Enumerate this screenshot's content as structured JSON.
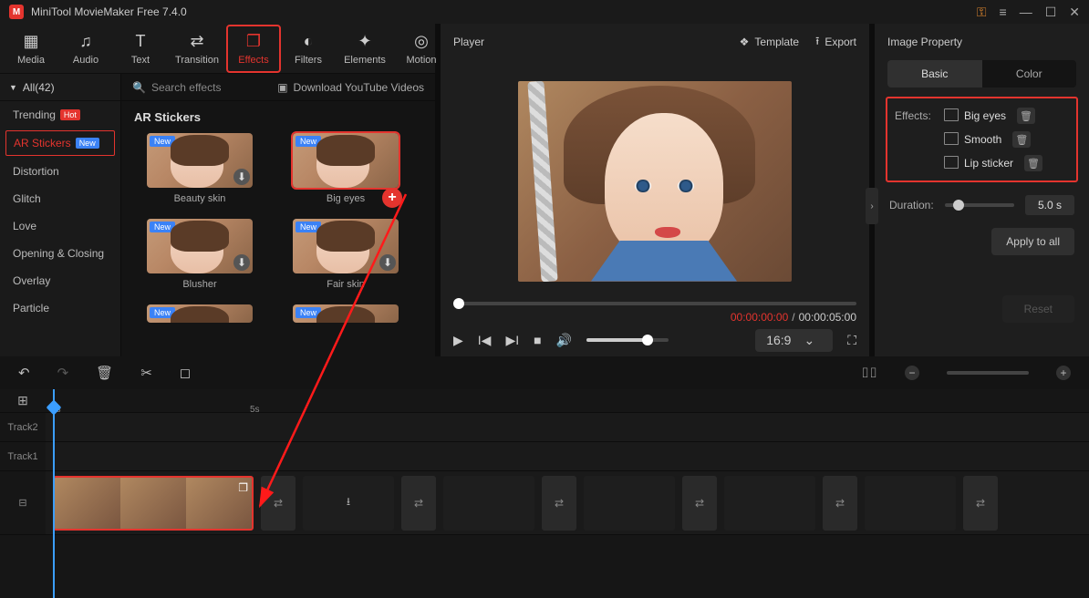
{
  "app": {
    "title": "MiniTool MovieMaker Free 7.4.0"
  },
  "tabs": [
    {
      "label": "Media"
    },
    {
      "label": "Audio"
    },
    {
      "label": "Text"
    },
    {
      "label": "Transition"
    },
    {
      "label": "Effects"
    },
    {
      "label": "Filters"
    },
    {
      "label": "Elements"
    },
    {
      "label": "Motion"
    }
  ],
  "categories": {
    "head": "All(42)",
    "search": "Search effects",
    "download": "Download YouTube Videos",
    "items": [
      {
        "label": "Trending",
        "badge": "Hot"
      },
      {
        "label": "AR Stickers",
        "badge": "New"
      },
      {
        "label": "Distortion"
      },
      {
        "label": "Glitch"
      },
      {
        "label": "Love"
      },
      {
        "label": "Opening & Closing"
      },
      {
        "label": "Overlay"
      },
      {
        "label": "Particle"
      }
    ]
  },
  "gallery": {
    "title": "AR Stickers",
    "thumbs": [
      {
        "name": "Beauty skin",
        "tag": "New"
      },
      {
        "name": "Big eyes",
        "tag": "New"
      },
      {
        "name": "Blusher",
        "tag": "New"
      },
      {
        "name": "Fair skin",
        "tag": "New"
      },
      {
        "name": "",
        "tag": "New"
      },
      {
        "name": "",
        "tag": "New"
      }
    ]
  },
  "player": {
    "title": "Player",
    "template": "Template",
    "export": "Export",
    "cur": "00:00:00:00",
    "sep": " / ",
    "tot": "00:00:05:00",
    "aspect": "16:9"
  },
  "props": {
    "title": "Image Property",
    "tabs": [
      "Basic",
      "Color"
    ],
    "effects_label": "Effects:",
    "effects": [
      "Big eyes",
      "Smooth",
      "Lip sticker"
    ],
    "duration_label": "Duration:",
    "duration_val": "5.0 s",
    "apply": "Apply to all",
    "reset": "Reset"
  },
  "timeline": {
    "ticks": [
      "0s",
      "5s"
    ],
    "tracks": [
      "Track2",
      "Track1"
    ]
  }
}
